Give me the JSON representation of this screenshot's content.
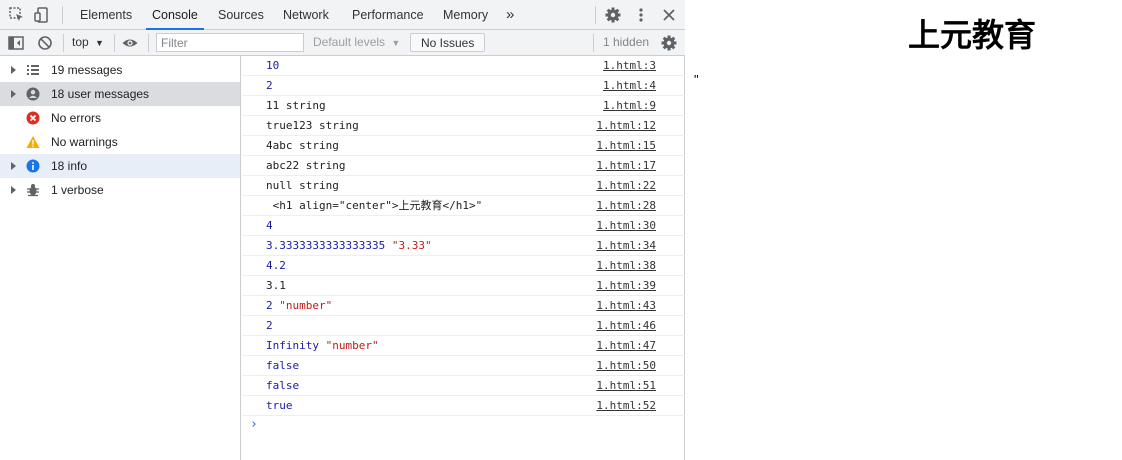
{
  "tabs": [
    "Elements",
    "Console",
    "Sources",
    "Network",
    "Performance",
    "Memory"
  ],
  "toolbar": {
    "context": "top",
    "filter_placeholder": "Filter",
    "levels": "Default levels",
    "issues": "No Issues",
    "hidden": "1 hidden"
  },
  "sidebar": [
    {
      "label": "19 messages",
      "icon": "list-icon"
    },
    {
      "label": "18 user messages",
      "icon": "user-icon"
    },
    {
      "label": "No errors",
      "icon": "error-icon"
    },
    {
      "label": "No warnings",
      "icon": "warning-icon"
    },
    {
      "label": "18 info",
      "icon": "info-icon"
    },
    {
      "label": "1 verbose",
      "icon": "bug-icon"
    }
  ],
  "messages": [
    {
      "parts": [
        {
          "t": "10",
          "k": "num"
        }
      ],
      "src": "1.html:3"
    },
    {
      "parts": [
        {
          "t": "2",
          "k": "num"
        }
      ],
      "src": "1.html:4"
    },
    {
      "parts": [
        {
          "t": "11 string",
          "k": "plain"
        }
      ],
      "src": "1.html:9"
    },
    {
      "parts": [
        {
          "t": "true123 string",
          "k": "plain"
        }
      ],
      "src": "1.html:12"
    },
    {
      "parts": [
        {
          "t": "4abc string",
          "k": "plain"
        }
      ],
      "src": "1.html:15"
    },
    {
      "parts": [
        {
          "t": "abc22 string",
          "k": "plain"
        }
      ],
      "src": "1.html:17"
    },
    {
      "parts": [
        {
          "t": "null string",
          "k": "plain"
        }
      ],
      "src": "1.html:22"
    },
    {
      "parts": [
        {
          "t": " <h1 align=\"center\">上元教育</h1>\"",
          "k": "plain"
        }
      ],
      "src": "1.html:28"
    },
    {
      "parts": [
        {
          "t": "4",
          "k": "num"
        }
      ],
      "src": "1.html:30"
    },
    {
      "parts": [
        {
          "t": "3.3333333333333335 ",
          "k": "num"
        },
        {
          "t": "\"3.33\"",
          "k": "str"
        }
      ],
      "src": "1.html:34"
    },
    {
      "parts": [
        {
          "t": "4.2",
          "k": "num"
        }
      ],
      "src": "1.html:38"
    },
    {
      "parts": [
        {
          "t": "3.1",
          "k": "plain"
        }
      ],
      "src": "1.html:39"
    },
    {
      "parts": [
        {
          "t": "2 ",
          "k": "num"
        },
        {
          "t": "\"number\"",
          "k": "str"
        }
      ],
      "src": "1.html:43"
    },
    {
      "parts": [
        {
          "t": "2",
          "k": "num"
        }
      ],
      "src": "1.html:46"
    },
    {
      "parts": [
        {
          "t": "Infinity ",
          "k": "num"
        },
        {
          "t": "\"number\"",
          "k": "str"
        }
      ],
      "src": "1.html:47"
    },
    {
      "parts": [
        {
          "t": "false",
          "k": "num"
        }
      ],
      "src": "1.html:50"
    },
    {
      "parts": [
        {
          "t": "false",
          "k": "num"
        }
      ],
      "src": "1.html:51"
    },
    {
      "parts": [
        {
          "t": "true",
          "k": "num"
        }
      ],
      "src": "1.html:52"
    }
  ],
  "page": {
    "title": "上元教育",
    "quote": "\""
  },
  "colors": {
    "accent": "#1a73e8",
    "number": "#1a1aa6",
    "string": "#c41a16"
  }
}
